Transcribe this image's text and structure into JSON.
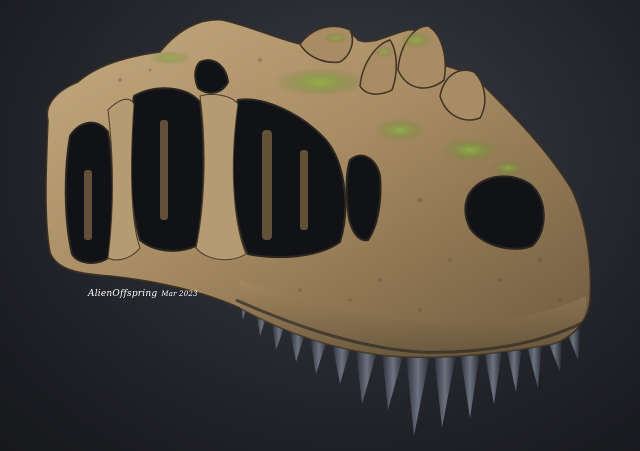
{
  "artwork": {
    "subject": "3D rendered dinosaur skull",
    "signature": {
      "name": "AlienOffspring",
      "date": "Mar 2023"
    }
  },
  "colors": {
    "background": "#1e2026",
    "bone_light": "#b49a73",
    "bone_mid": "#8f7552",
    "bone_dark": "#5c4a34",
    "moss": "#7aa13a",
    "cavity": "#111216",
    "teeth": "#3a3e48"
  }
}
